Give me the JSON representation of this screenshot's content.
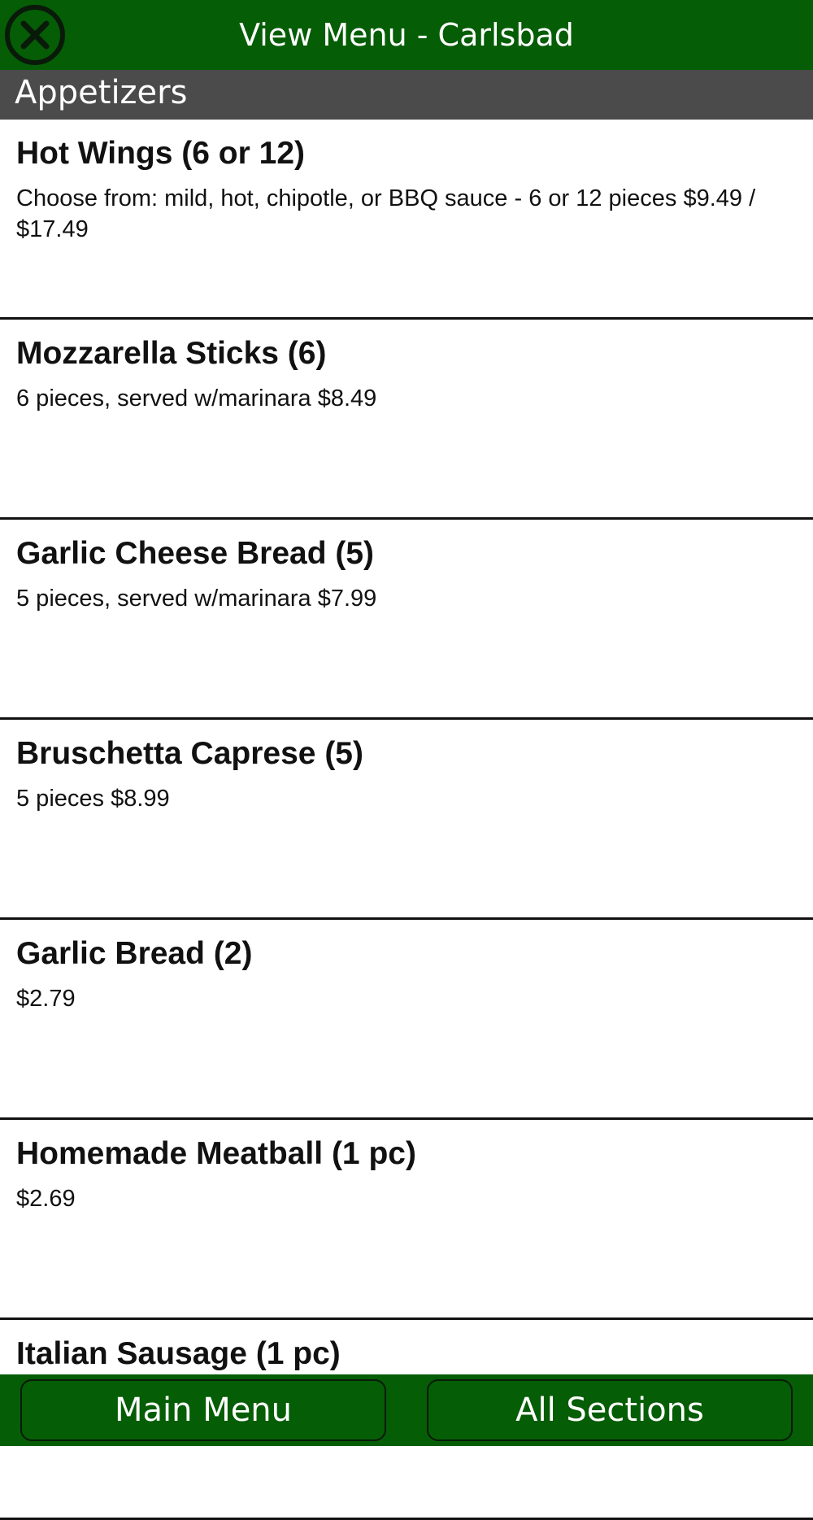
{
  "header": {
    "title": "View Menu - Carlsbad",
    "close_icon": "close-circle-icon"
  },
  "section": {
    "title": "Appetizers"
  },
  "items": [
    {
      "name": "Hot Wings (6 or 12)",
      "desc": "Choose from: mild, hot, chipotle, or BBQ sauce - 6 or 12 pieces $9.49 / $17.49"
    },
    {
      "name": "Mozzarella Sticks (6)",
      "desc": "6 pieces, served w/marinara $8.49"
    },
    {
      "name": "Garlic Cheese Bread (5)",
      "desc": "5 pieces, served w/marinara $7.99"
    },
    {
      "name": "Bruschetta Caprese (5)",
      "desc": "5 pieces $8.99"
    },
    {
      "name": "Garlic Bread (2)",
      "desc": "$2.79"
    },
    {
      "name": "Homemade Meatball (1 pc)",
      "desc": "$2.69"
    },
    {
      "name": "Italian Sausage (1 pc)",
      "desc": ""
    }
  ],
  "footer": {
    "main_menu_label": "Main Menu",
    "all_sections_label": "All Sections"
  },
  "colors": {
    "header_green": "#055d05",
    "section_gray": "#4b4b4b",
    "divider": "#111111"
  }
}
